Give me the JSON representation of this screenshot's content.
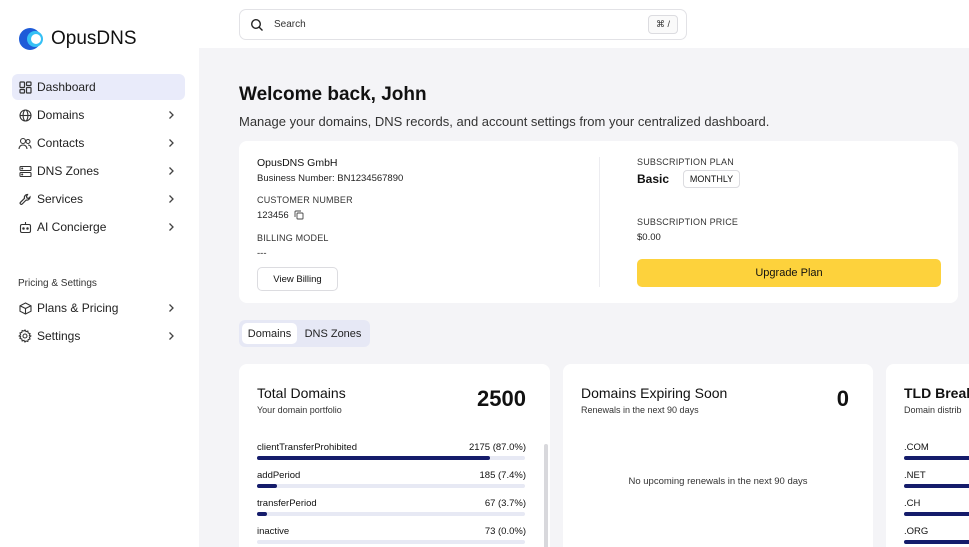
{
  "app": {
    "name": "OpusDNS"
  },
  "search": {
    "placeholder": "Search",
    "shortcut": "⌘ /"
  },
  "sidebar": {
    "items": [
      {
        "label": "Dashboard",
        "icon": "dashboard-icon",
        "active": true
      },
      {
        "label": "Domains",
        "icon": "globe-icon"
      },
      {
        "label": "Contacts",
        "icon": "users-icon"
      },
      {
        "label": "DNS Zones",
        "icon": "server-icon"
      },
      {
        "label": "Services",
        "icon": "wrench-icon"
      },
      {
        "label": "AI Concierge",
        "icon": "bot-icon"
      }
    ],
    "section_label": "Pricing & Settings",
    "settings_items": [
      {
        "label": "Plans & Pricing",
        "icon": "box-icon"
      },
      {
        "label": "Settings",
        "icon": "gear-icon"
      }
    ]
  },
  "header": {
    "welcome": "Welcome back, John",
    "subtitle": "Manage your domains, DNS records, and account settings from your centralized dashboard."
  },
  "account": {
    "company": "OpusDNS GmbH",
    "business_number": "Business Number: BN1234567890",
    "customer_number_label": "CUSTOMER NUMBER",
    "customer_number": "123456",
    "billing_model_label": "BILLING MODEL",
    "billing_model": "---",
    "view_billing": "View Billing",
    "plan_label": "SUBSCRIPTION PLAN",
    "plan": "Basic",
    "plan_cycle": "MONTHLY",
    "price_label": "SUBSCRIPTION PRICE",
    "price": "$0.00",
    "upgrade": "Upgrade Plan"
  },
  "tabs": [
    {
      "label": "Domains",
      "active": true
    },
    {
      "label": "DNS Zones"
    }
  ],
  "total_domains": {
    "title": "Total Domains",
    "subtitle": "Your domain portfolio",
    "count": "2500",
    "rows": [
      {
        "label": "clientTransferProhibited",
        "value": "2175 (87.0%)",
        "fraction": 0.87
      },
      {
        "label": "addPeriod",
        "value": "185 (7.4%)",
        "fraction": 0.074
      },
      {
        "label": "transferPeriod",
        "value": "67 (3.7%)",
        "fraction": 0.037
      },
      {
        "label": "inactive",
        "value": "73 (0.0%)",
        "fraction": 0.0
      }
    ]
  },
  "expiring": {
    "title": "Domains Expiring Soon",
    "subtitle": "Renewals in the next 90 days",
    "count": "0",
    "empty": "No upcoming renewals in the next 90 days"
  },
  "tld": {
    "title": "TLD Break",
    "subtitle": "Domain distrib",
    "items": [
      ".COM",
      ".NET",
      ".CH",
      ".ORG"
    ]
  },
  "colors": {
    "accent": "#151c6b",
    "upgrade": "#fdd23c",
    "active_nav": "#e9ebfa"
  }
}
